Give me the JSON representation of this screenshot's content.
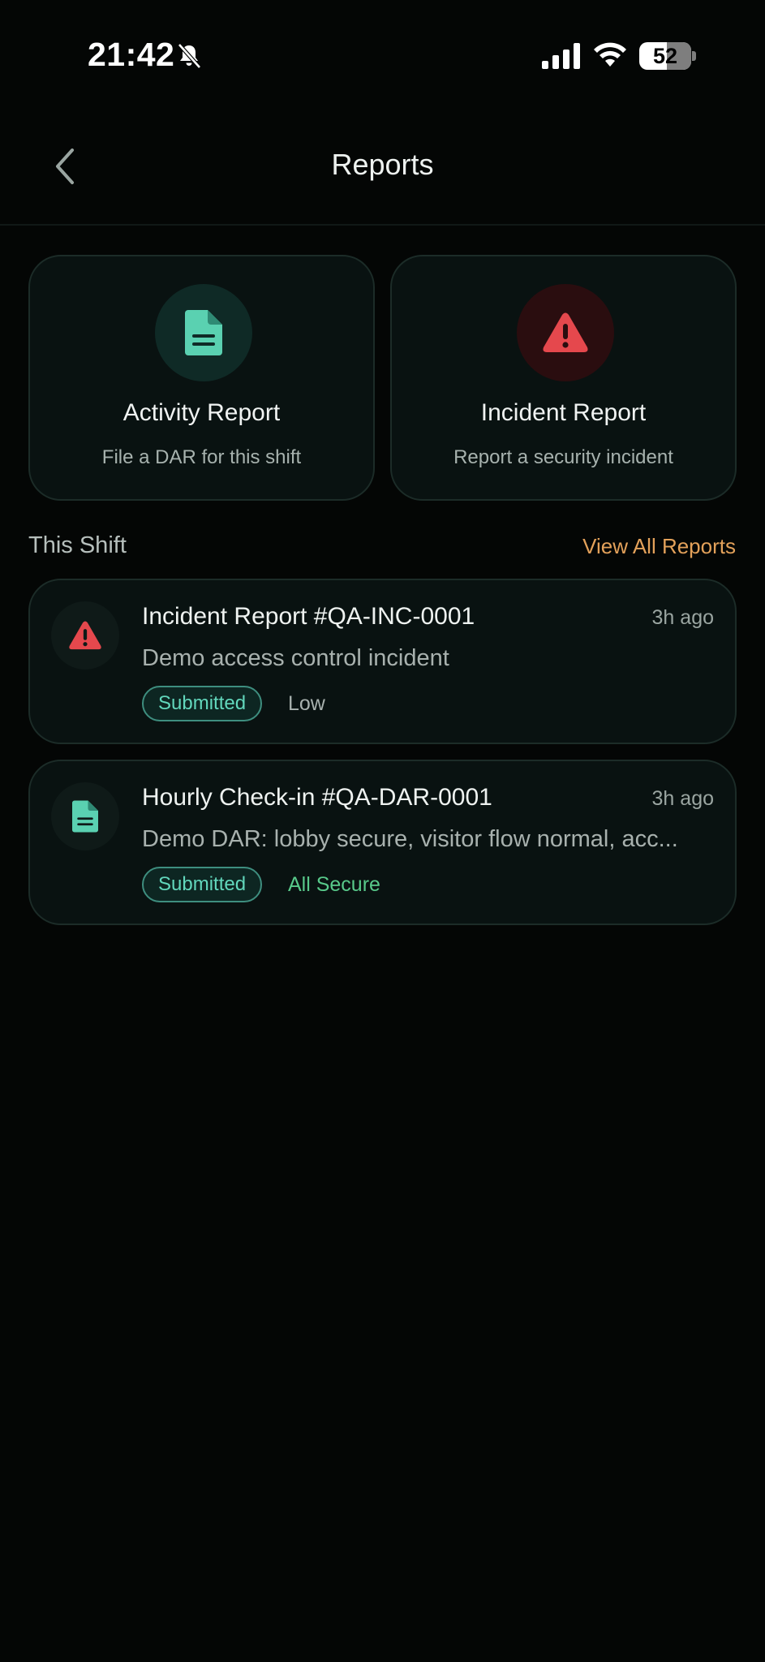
{
  "status_bar": {
    "time": "21:42",
    "battery": "52",
    "icons": [
      "bell-slash-icon",
      "signal-icon",
      "wifi-icon",
      "battery-icon"
    ]
  },
  "header": {
    "title": "Reports",
    "back_icon": "chevron-left-icon"
  },
  "actions": [
    {
      "title": "Activity Report",
      "subtitle": "File a DAR for this shift",
      "icon": "document-icon",
      "icon_color": "#5ad1b1",
      "icon_bg": "#0f2a26"
    },
    {
      "title": "Incident Report",
      "subtitle": "Report a security incident",
      "icon": "warning-icon",
      "icon_color": "#e5484d",
      "icon_bg": "#2a0d0f"
    }
  ],
  "section": {
    "title": "This Shift",
    "view_all": "View All Reports"
  },
  "reports": [
    {
      "title": "Incident Report #QA-INC-0001",
      "time": "3h ago",
      "description": "Demo access control incident",
      "status": "Submitted",
      "severity": "Low",
      "icon": "warning-icon"
    },
    {
      "title": "Hourly Check-in #QA-DAR-0001",
      "time": "3h ago",
      "description": "Demo DAR: lobby secure, visitor flow normal, acc...",
      "status": "Submitted",
      "severity": "All Secure",
      "icon": "document-icon"
    }
  ],
  "colors": {
    "background": "#040605",
    "card": "#091211",
    "accent": "#5ad1b1",
    "danger": "#e5484d",
    "link": "#e3a15a",
    "secure": "#58c98a"
  }
}
